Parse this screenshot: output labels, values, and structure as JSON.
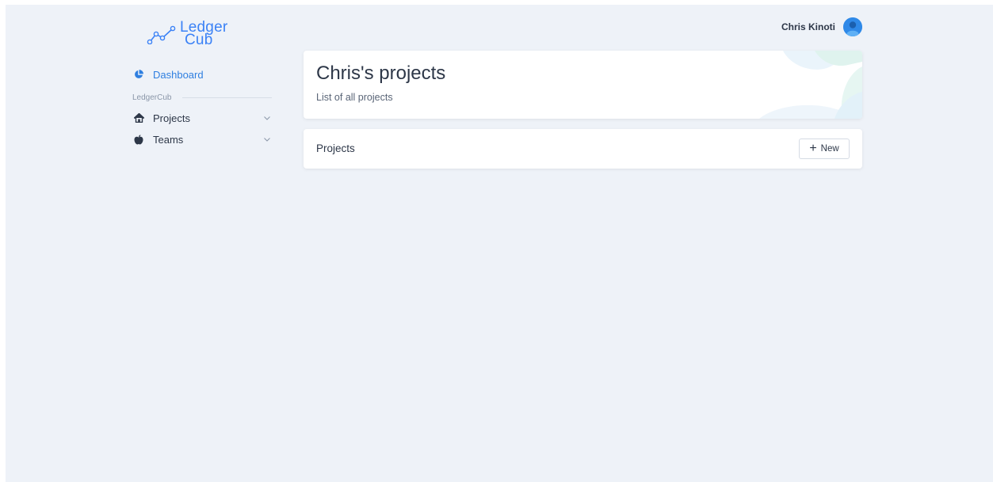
{
  "brand": {
    "name_line1": "Ledger",
    "name_line2": "Cub",
    "color": "#3b82f6"
  },
  "user": {
    "name": "Chris Kinoti",
    "avatar_icon": "user-avatar-icon"
  },
  "sidebar": {
    "dashboard": {
      "label": "Dashboard",
      "icon": "pie-chart-icon"
    },
    "section_label": "LedgerCub",
    "items": [
      {
        "label": "Projects",
        "icon": "home-icon"
      },
      {
        "label": "Teams",
        "icon": "apple-icon"
      }
    ],
    "active_color": "#2f7fe0"
  },
  "main": {
    "hero": {
      "title": "Chris's projects",
      "subtitle": "List of all projects"
    },
    "projects_card": {
      "title": "Projects",
      "new_button": "New"
    }
  }
}
